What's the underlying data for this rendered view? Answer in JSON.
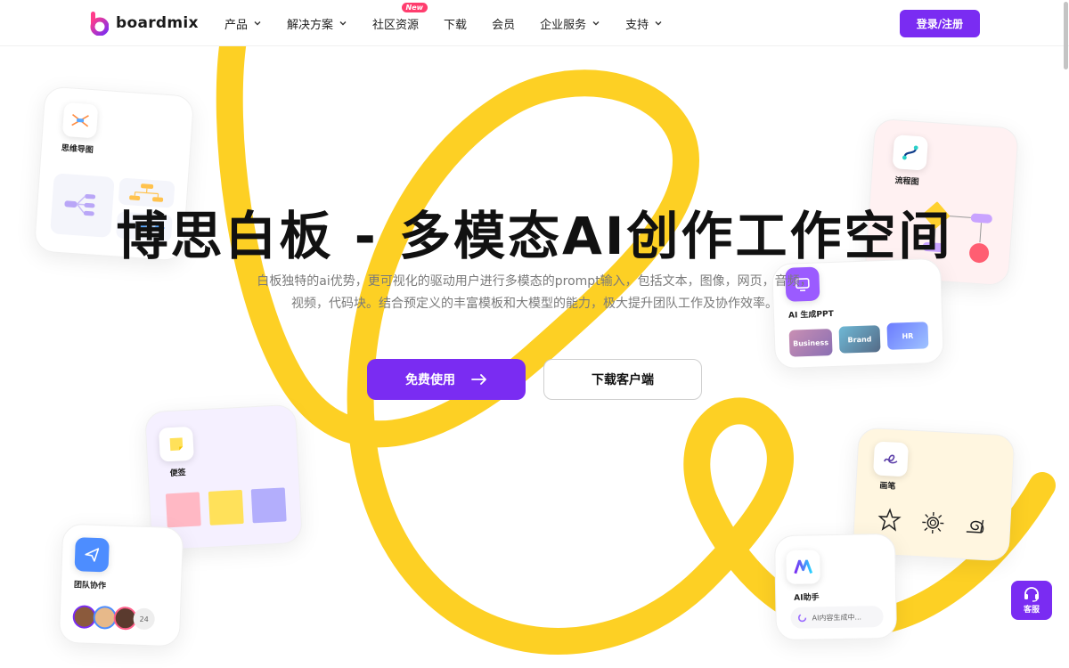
{
  "brand": {
    "name": "boardmix",
    "accent": "#7a2cf2",
    "yellow": "#fdd024"
  },
  "nav": {
    "items": [
      {
        "label": "产品",
        "dropdown": true
      },
      {
        "label": "解决方案",
        "dropdown": true
      },
      {
        "label": "社区资源",
        "dropdown": false,
        "badge": "New"
      },
      {
        "label": "下载",
        "dropdown": false
      },
      {
        "label": "会员",
        "dropdown": false
      },
      {
        "label": "企业服务",
        "dropdown": true
      },
      {
        "label": "支持",
        "dropdown": true
      }
    ],
    "login_label": "登录/注册"
  },
  "hero": {
    "title": "博思白板 - 多模态AI创作工作空间",
    "desc_line1": "白板独特的ai优势，更可视化的驱动用户进行多模态的prompt输入，包括文本，图像，网页，音频，",
    "desc_line2": "视频，代码块。结合预定义的丰富模板和大模型的能力，极大提升团队工作及协作效率。",
    "cta_primary": "免费使用",
    "cta_primary_icon": "arrow-right-icon",
    "cta_secondary": "下载客户端"
  },
  "cards": {
    "mindmap": {
      "label": "思维导图",
      "icon": "mindmap-icon"
    },
    "flowchart": {
      "label": "流程图",
      "icon": "flowchart-icon"
    },
    "ai_ppt": {
      "label": "AI 生成PPT",
      "icon": "ppt-icon",
      "templates": [
        "Business",
        "Brand",
        "HR"
      ]
    },
    "sticky": {
      "label": "便签",
      "icon": "sticky-note-icon",
      "colors": [
        "#ffb8c4",
        "#ffe15a",
        "#b3aefc"
      ]
    },
    "pen": {
      "label": "画笔",
      "icon": "pen-icon"
    },
    "team": {
      "label": "团队协作",
      "icon": "send-icon",
      "extra_count": "24"
    },
    "ai_assistant": {
      "label": "AI助手",
      "icon": "ai-logo-icon",
      "input_placeholder": "AI内容生成中..."
    }
  },
  "service": {
    "label": "客服",
    "icon": "headset-icon"
  }
}
